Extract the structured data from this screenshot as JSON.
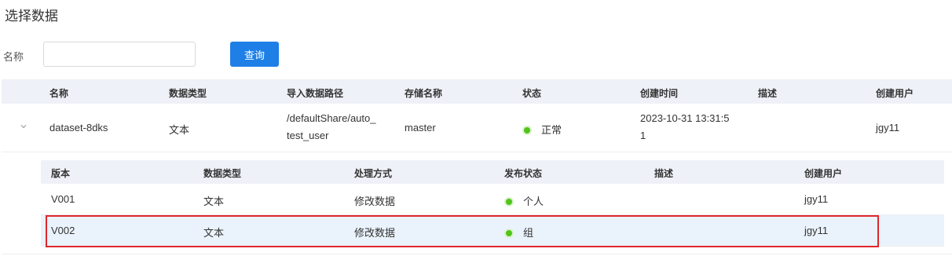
{
  "dialog": {
    "title": "选择数据"
  },
  "search": {
    "label": "名称",
    "value": "",
    "placeholder": "",
    "button_label": "查询"
  },
  "outer_table": {
    "columns": [
      "名称",
      "数据类型",
      "导入数据路径",
      "存储名称",
      "状态",
      "创建时间",
      "描述",
      "创建用户"
    ],
    "rows": [
      {
        "name": "dataset-8dks",
        "type": "文本",
        "path_line1": "/defaultShare/auto_",
        "path_line2": "test_user",
        "storage": "master",
        "status": "正常",
        "created_line1": "2023-10-31 13:31:5",
        "created_line2": "1",
        "description": "",
        "user": "jgy11",
        "expanded": true
      }
    ]
  },
  "inner_table": {
    "columns": [
      "版本",
      "数据类型",
      "处理方式",
      "发布状态",
      "描述",
      "创建用户"
    ],
    "rows": [
      {
        "version": "V001",
        "type": "文本",
        "process": "修改数据",
        "publish": "个人",
        "description": "",
        "user": "jgy11",
        "selected": false
      },
      {
        "version": "V002",
        "type": "文本",
        "process": "修改数据",
        "publish": "组",
        "description": "",
        "user": "jgy11",
        "selected": true
      }
    ]
  },
  "colors": {
    "primary": "#1e7fe6",
    "header_bg": "#eef1f7",
    "selected_bg": "#eaf3fc",
    "status_ok": "#52c41a",
    "highlight": "#e0272d"
  }
}
